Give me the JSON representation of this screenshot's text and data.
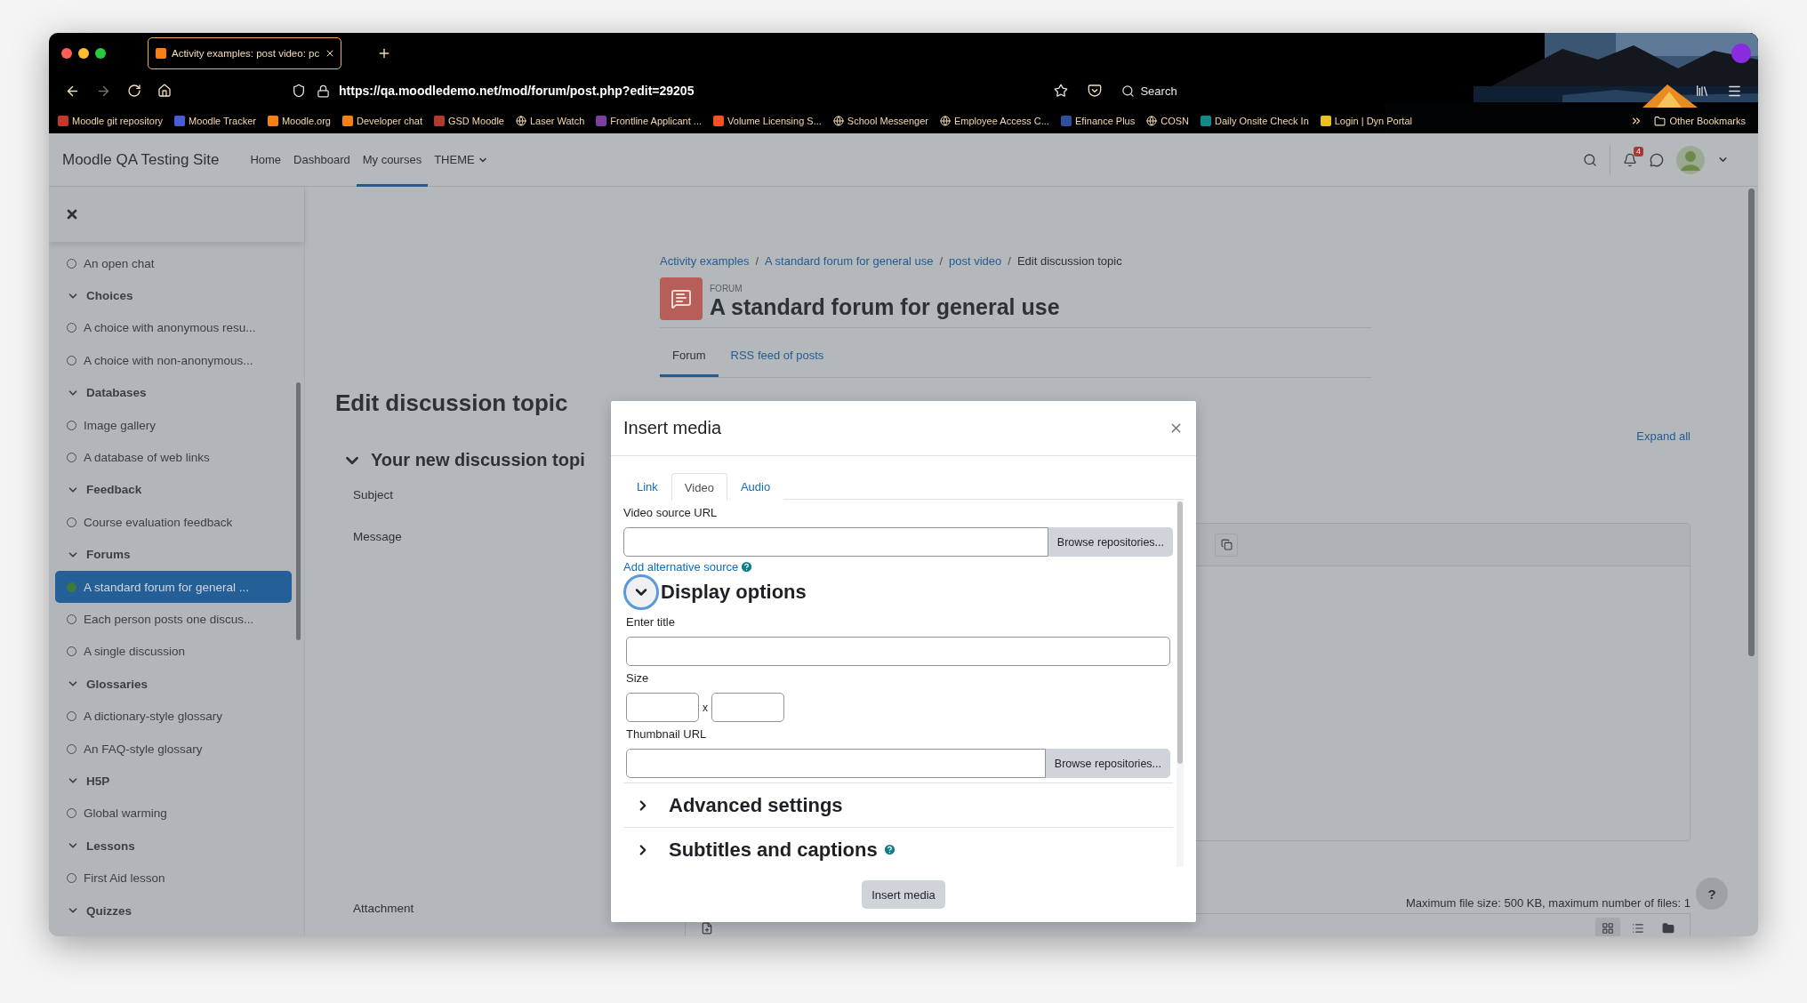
{
  "browser": {
    "tab_title": "Activity examples: post video: pc",
    "url": "https://qa.moodledemo.net/mod/forum/post.php?edit=29205",
    "search_label": "Search",
    "bookmarks": [
      {
        "label": "Moodle git repository",
        "kind": "favicon",
        "color": "#c0392b"
      },
      {
        "label": "Moodle Tracker",
        "kind": "favicon",
        "color": "#4a5bd4"
      },
      {
        "label": "Moodle.org",
        "kind": "favicon",
        "color": "#f98012"
      },
      {
        "label": "Developer chat",
        "kind": "favicon",
        "color": "#f98012"
      },
      {
        "label": "GSD Moodle",
        "kind": "favicon",
        "color": "#b03a2e"
      },
      {
        "label": "Laser Watch",
        "kind": "generic"
      },
      {
        "label": "Frontline Applicant ...",
        "kind": "favicon",
        "color": "#7b3fa0"
      },
      {
        "label": "Volume Licensing S...",
        "kind": "favicon",
        "color": "#f35325"
      },
      {
        "label": "School Messenger",
        "kind": "generic"
      },
      {
        "label": "Employee Access C...",
        "kind": "generic"
      },
      {
        "label": "Efinance Plus",
        "kind": "favicon",
        "color": "#2d4f9e"
      },
      {
        "label": "COSN",
        "kind": "generic"
      },
      {
        "label": "Daily Onsite Check In",
        "kind": "favicon",
        "color": "#138a8a"
      },
      {
        "label": "Login | Dyn Portal",
        "kind": "favicon",
        "color": "#e8c020"
      }
    ],
    "other_bookmarks": "Other Bookmarks"
  },
  "site": {
    "name": "Moodle QA Testing Site",
    "nav": [
      {
        "label": "Home",
        "selected": false,
        "menu": false
      },
      {
        "label": "Dashboard",
        "selected": false,
        "menu": false
      },
      {
        "label": "My courses",
        "selected": true,
        "menu": false
      },
      {
        "label": "THEME",
        "selected": false,
        "menu": true
      }
    ],
    "notification_count": "4"
  },
  "sidebar": {
    "items": [
      {
        "kind": "activity",
        "label": "An open chat",
        "selected": false
      },
      {
        "kind": "section",
        "label": "Choices",
        "expanded": true,
        "children": [
          {
            "kind": "activity",
            "label": "A choice with anonymous resu...",
            "selected": false
          },
          {
            "kind": "activity",
            "label": "A choice with non-anonymous...",
            "selected": false
          }
        ]
      },
      {
        "kind": "section",
        "label": "Databases",
        "expanded": true,
        "children": [
          {
            "kind": "activity",
            "label": "Image gallery",
            "selected": false
          },
          {
            "kind": "activity",
            "label": "A database of web links",
            "selected": false
          }
        ]
      },
      {
        "kind": "section",
        "label": "Feedback",
        "expanded": true,
        "children": [
          {
            "kind": "activity",
            "label": "Course evaluation feedback",
            "selected": false
          }
        ]
      },
      {
        "kind": "section",
        "label": "Forums",
        "expanded": true,
        "children": [
          {
            "kind": "activity",
            "label": "A standard forum for general ...",
            "selected": true
          },
          {
            "kind": "activity",
            "label": "Each person posts one discus...",
            "selected": false
          },
          {
            "kind": "activity",
            "label": "A single discussion",
            "selected": false
          }
        ]
      },
      {
        "kind": "section",
        "label": "Glossaries",
        "expanded": true,
        "children": [
          {
            "kind": "activity",
            "label": "A dictionary-style glossary",
            "selected": false
          },
          {
            "kind": "activity",
            "label": "An FAQ-style glossary",
            "selected": false
          }
        ]
      },
      {
        "kind": "section",
        "label": "H5P",
        "expanded": true,
        "children": [
          {
            "kind": "activity",
            "label": "Global warming",
            "selected": false
          }
        ]
      },
      {
        "kind": "section",
        "label": "Lessons",
        "expanded": true,
        "children": [
          {
            "kind": "activity",
            "label": "First Aid lesson",
            "selected": false
          }
        ]
      },
      {
        "kind": "section",
        "label": "Quizzes",
        "expanded": true
      }
    ]
  },
  "page": {
    "breadcrumb": [
      {
        "label": "Activity examples",
        "link": true
      },
      {
        "label": "A standard forum for general use",
        "link": true
      },
      {
        "label": "post video",
        "link": true
      },
      {
        "label": "Edit discussion topic",
        "link": false
      }
    ],
    "breadcrumb_separator": "/",
    "activity_type": "FORUM",
    "title": "A standard forum for general use",
    "tabs": [
      {
        "label": "Forum",
        "selected": true
      },
      {
        "label": "RSS feed of posts",
        "selected": false
      }
    ],
    "heading": "Edit discussion topic",
    "expand_all": "Expand all",
    "section": {
      "title": "Your new discussion topi",
      "expanded": true
    },
    "fields": [
      {
        "kind": "text",
        "label": "Subject"
      },
      {
        "kind": "editor",
        "label": "Message"
      },
      {
        "kind": "files",
        "label": "Attachment",
        "note": "Maximum file size: 500 KB, maximum number of files: 1"
      }
    ],
    "help_button": "?"
  },
  "dialog": {
    "title": "Insert media",
    "tabs": [
      {
        "label": "Link",
        "selected": false
      },
      {
        "label": "Video",
        "selected": true
      },
      {
        "label": "Audio",
        "selected": false
      }
    ],
    "source_label": "Video source URL",
    "browse": "Browse repositories...",
    "add_source": "Add alternative source",
    "display_options": {
      "title": "Display options",
      "expanded": true
    },
    "title_label": "Enter title",
    "size_label": "Size",
    "size_separator": "x",
    "thumbnail_label": "Thumbnail URL",
    "thumbnail_browse": "Browse repositories...",
    "sections": [
      {
        "title": "Advanced settings",
        "expanded": false,
        "help": false
      },
      {
        "title": "Subtitles and captions",
        "expanded": false,
        "help": true
      }
    ],
    "submit": "Insert media"
  }
}
